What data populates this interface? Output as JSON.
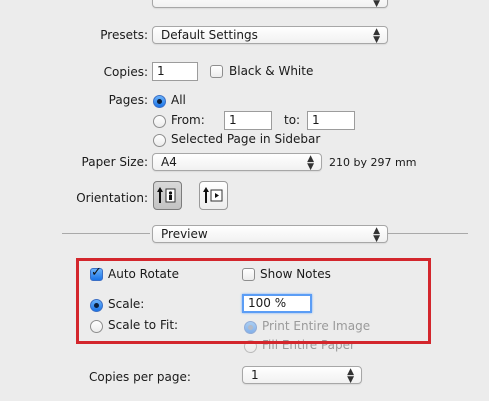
{
  "presets": {
    "label": "Presets:",
    "value": "Default Settings"
  },
  "copies": {
    "label": "Copies:",
    "value": "1",
    "bw_label": "Black & White"
  },
  "pages": {
    "label": "Pages:",
    "all_label": "All",
    "from_label": "From:",
    "from_value": "1",
    "to_label": "to:",
    "to_value": "1",
    "sidebar_label": "Selected Page in Sidebar"
  },
  "paper_size": {
    "label": "Paper Size:",
    "value": "A4",
    "dimensions": "210 by 297 mm"
  },
  "orientation": {
    "label": "Orientation:"
  },
  "section": {
    "value": "Preview"
  },
  "preview": {
    "auto_rotate_label": "Auto Rotate",
    "auto_rotate_checked": true,
    "show_notes_label": "Show Notes",
    "show_notes_checked": false,
    "scale_label": "Scale:",
    "scale_value": "100 %",
    "scale_to_fit_label": "Scale to Fit:",
    "print_entire_image_label": "Print Entire Image",
    "fill_entire_paper_label": "Fill Entire Paper",
    "copies_per_page_label": "Copies per page:",
    "copies_per_page_value": "1"
  },
  "colors": {
    "accent": "#1a74e8",
    "highlight_border": "#d3262c"
  }
}
